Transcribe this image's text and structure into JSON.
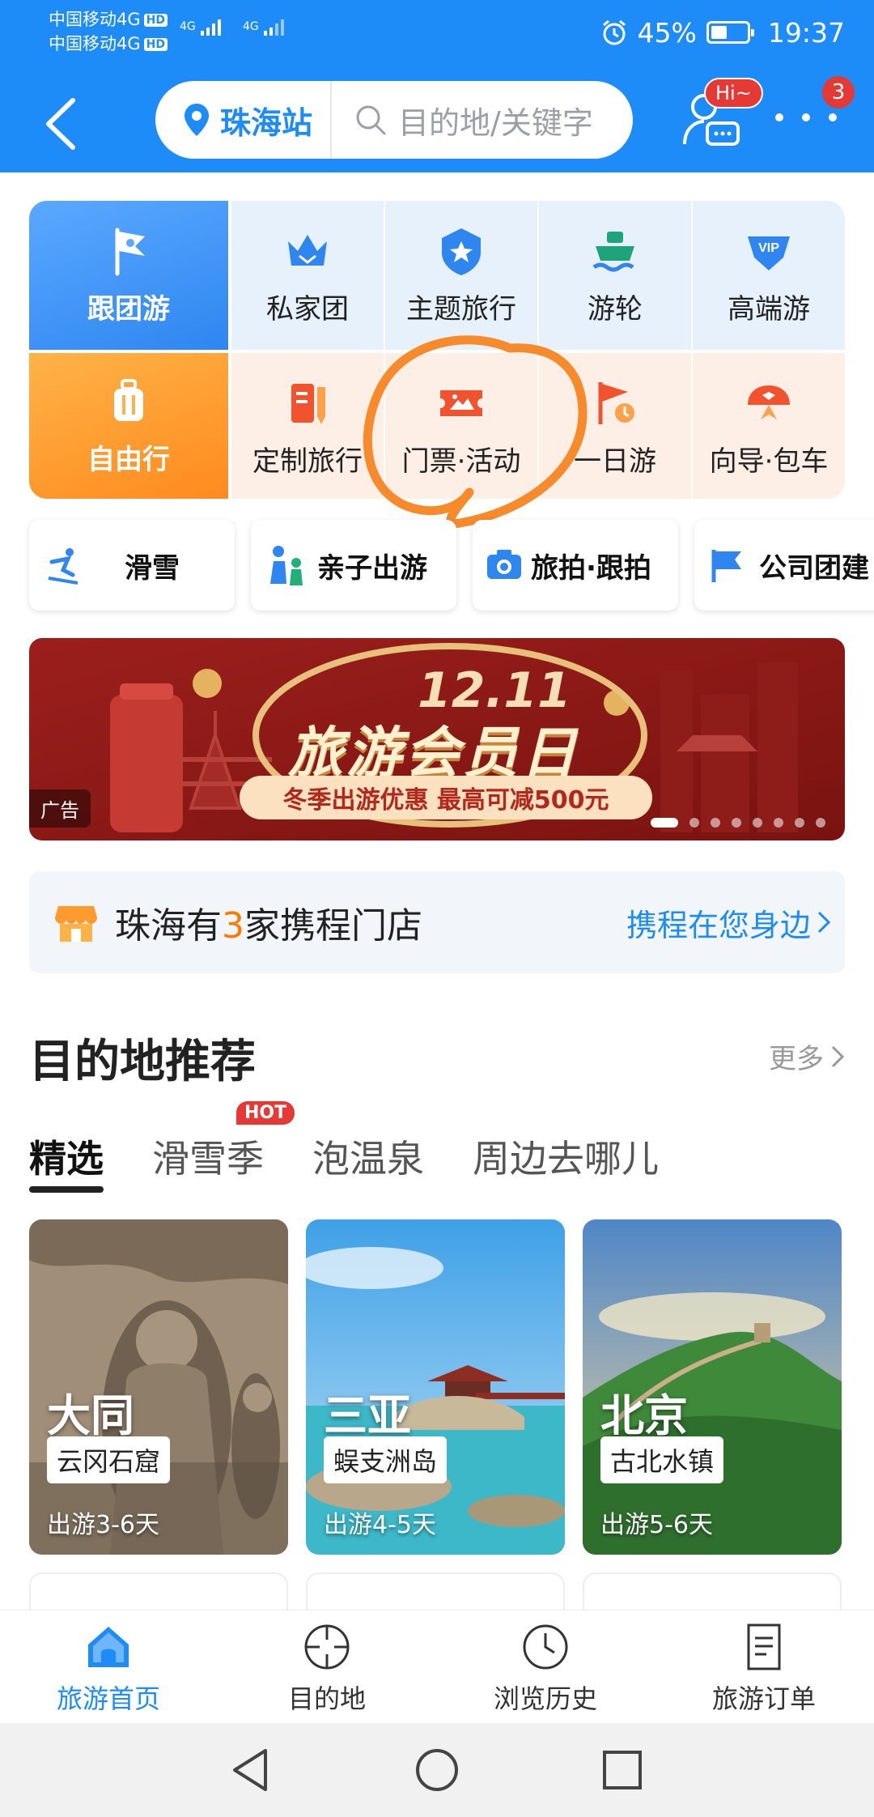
{
  "status_bar": {
    "carrier_1": "中国移动4G",
    "carrier_2": "中国移动4G",
    "hd": "HD",
    "signal_label": "4G",
    "battery_percent": "45%",
    "battery_level": 0.45,
    "time": "19:37"
  },
  "header": {
    "station": "珠海站",
    "search_placeholder": "目的地/关键字",
    "hi_badge": "Hi~",
    "more_badge": "3"
  },
  "grid": {
    "row1": [
      {
        "label": "跟团游",
        "icon": "flag-icon"
      },
      {
        "label": "私家团",
        "icon": "crown-icon"
      },
      {
        "label": "主题旅行",
        "icon": "star-shield-icon"
      },
      {
        "label": "游轮",
        "icon": "ship-icon"
      },
      {
        "label": "高端游",
        "icon": "vip-icon"
      }
    ],
    "row2": [
      {
        "label": "自由行",
        "icon": "luggage-icon"
      },
      {
        "label": "定制旅行",
        "icon": "pencil-book-icon"
      },
      {
        "label": "门票·活动",
        "icon": "ticket-icon"
      },
      {
        "label": "一日游",
        "icon": "flag-clock-icon"
      },
      {
        "label": "向导·包车",
        "icon": "guide-hat-icon"
      }
    ]
  },
  "chips": [
    {
      "label": "滑雪",
      "icon": "ski-icon"
    },
    {
      "label": "亲子出游",
      "icon": "family-icon"
    },
    {
      "label": "旅拍·跟拍",
      "icon": "camera-icon"
    },
    {
      "label": "公司团建",
      "icon": "company-flag-icon"
    }
  ],
  "banner": {
    "date": "12.11",
    "title": "旅游会员日",
    "subtitle": "冬季出游优惠 最高可减500元",
    "ad_label": "广告",
    "slide_count": 8,
    "active_slide": 1
  },
  "store": {
    "prefix": "珠海有",
    "count": "3",
    "suffix": "家携程门店",
    "link": "携程在您身边"
  },
  "destinations": {
    "title": "目的地推荐",
    "more": "更多",
    "tabs": [
      {
        "label": "精选",
        "active": true
      },
      {
        "label": "滑雪季",
        "badge": "HOT"
      },
      {
        "label": "泡温泉"
      },
      {
        "label": "周边去哪儿"
      }
    ],
    "cards": [
      {
        "city": "大同",
        "spot": "云冈石窟",
        "days": "出游3-6天"
      },
      {
        "city": "三亚",
        "spot": "蜈支洲岛",
        "days": "出游4-5天"
      },
      {
        "city": "北京",
        "spot": "古北水镇",
        "days": "出游5-6天"
      }
    ]
  },
  "bottom_nav": [
    {
      "label": "旅游首页",
      "icon": "home-icon",
      "active": true
    },
    {
      "label": "目的地",
      "icon": "crosshair-icon"
    },
    {
      "label": "浏览历史",
      "icon": "clock-icon"
    },
    {
      "label": "旅游订单",
      "icon": "order-list-icon"
    }
  ],
  "colors": {
    "brand_blue": "#1d8cf8",
    "badge_red": "#e53935",
    "accent_orange": "#ff7a00",
    "annotation_orange": "#f78a2b"
  }
}
